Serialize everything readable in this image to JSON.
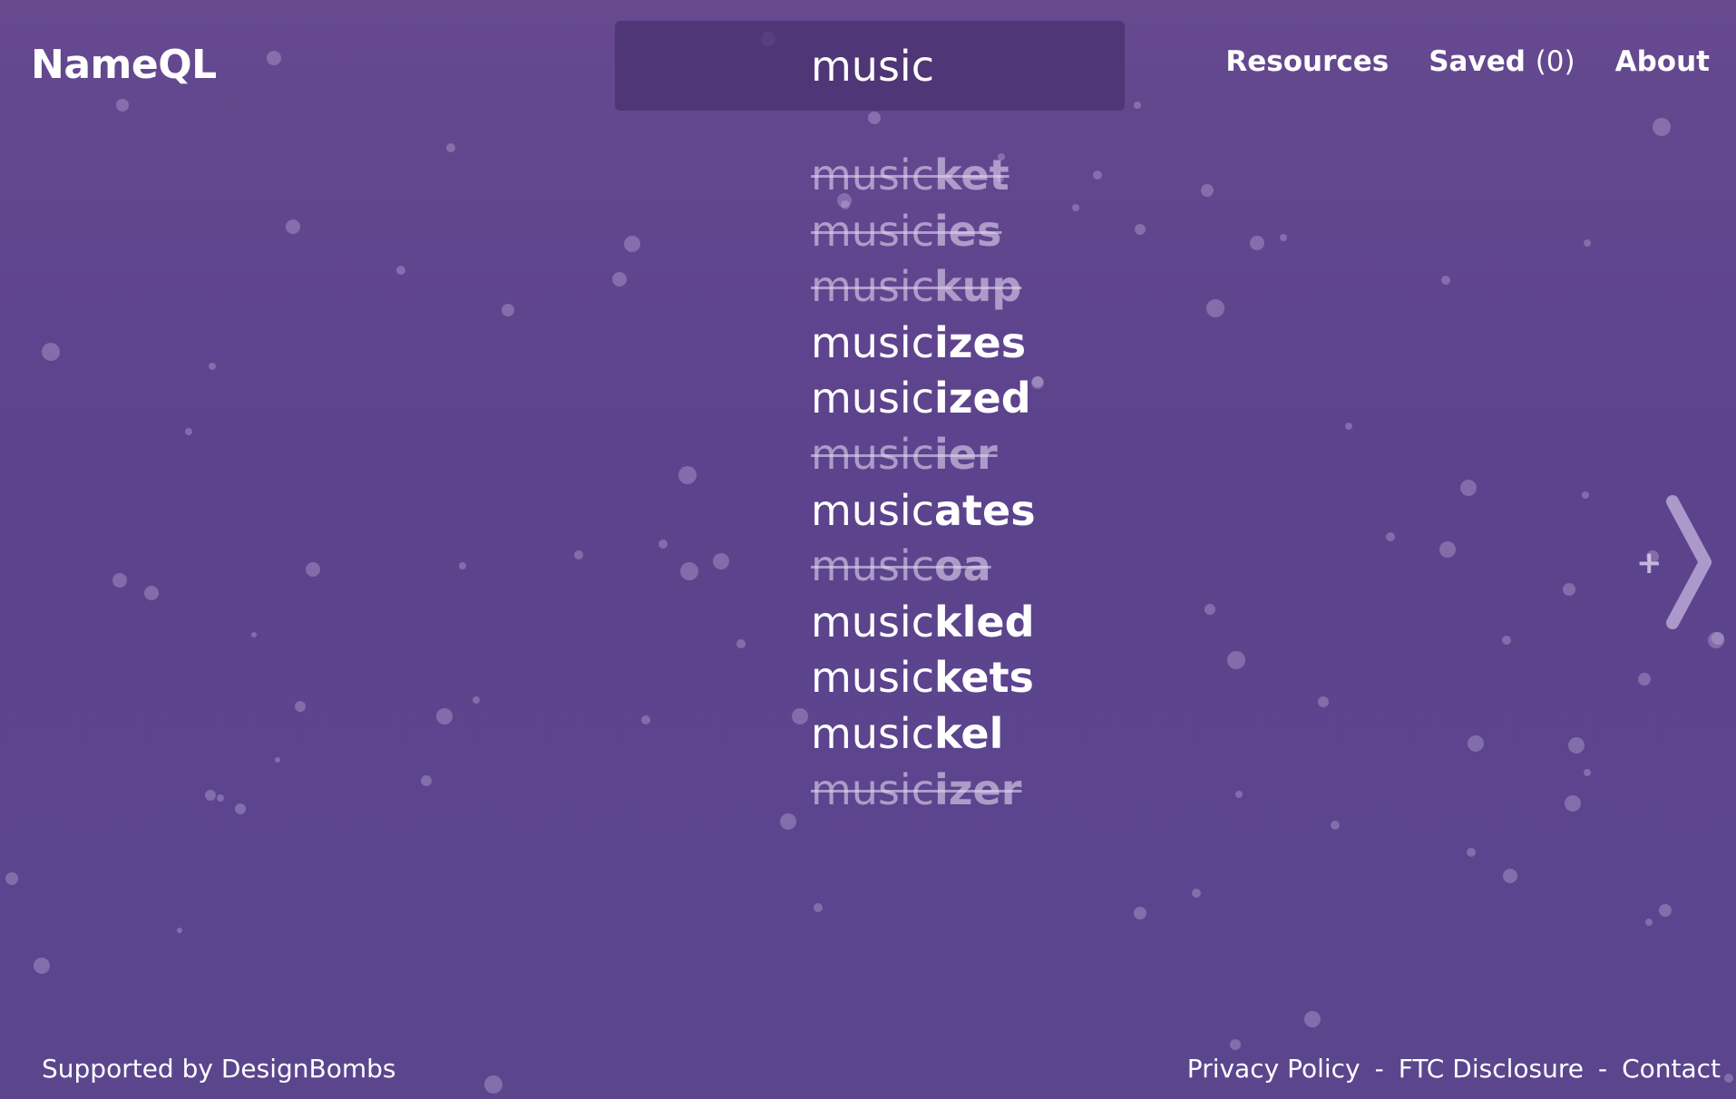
{
  "header": {
    "logo": "NameQL",
    "nav": {
      "resources": "Resources",
      "saved_label": "Saved",
      "saved_count": "(0)",
      "about": "About"
    }
  },
  "search": {
    "value": "music"
  },
  "results": [
    {
      "prefix": "music",
      "suffix": "ket",
      "taken": true
    },
    {
      "prefix": "music",
      "suffix": "ies",
      "taken": true
    },
    {
      "prefix": "music",
      "suffix": "kup",
      "taken": true
    },
    {
      "prefix": "music",
      "suffix": "izes",
      "taken": false
    },
    {
      "prefix": "music",
      "suffix": "ized",
      "taken": false
    },
    {
      "prefix": "music",
      "suffix": "ier",
      "taken": true
    },
    {
      "prefix": "music",
      "suffix": "ates",
      "taken": false
    },
    {
      "prefix": "music",
      "suffix": "oa",
      "taken": true
    },
    {
      "prefix": "music",
      "suffix": "kled",
      "taken": false
    },
    {
      "prefix": "music",
      "suffix": "kets",
      "taken": false
    },
    {
      "prefix": "music",
      "suffix": "kel",
      "taken": false
    },
    {
      "prefix": "music",
      "suffix": "izer",
      "taken": true
    }
  ],
  "side_action": {
    "plus_icon": "plus-icon",
    "next_icon": "chevron-right-icon"
  },
  "footer": {
    "supported_by": "Supported by DesignBombs",
    "links": [
      "Privacy Policy",
      "FTC Disclosure",
      "Contact"
    ],
    "separator": "-"
  },
  "colors": {
    "background_top": "#66498f",
    "background_bottom": "#5b468e",
    "search_box": "#48306e",
    "text": "#ffffff",
    "taken_text": "#ddd2ee"
  }
}
